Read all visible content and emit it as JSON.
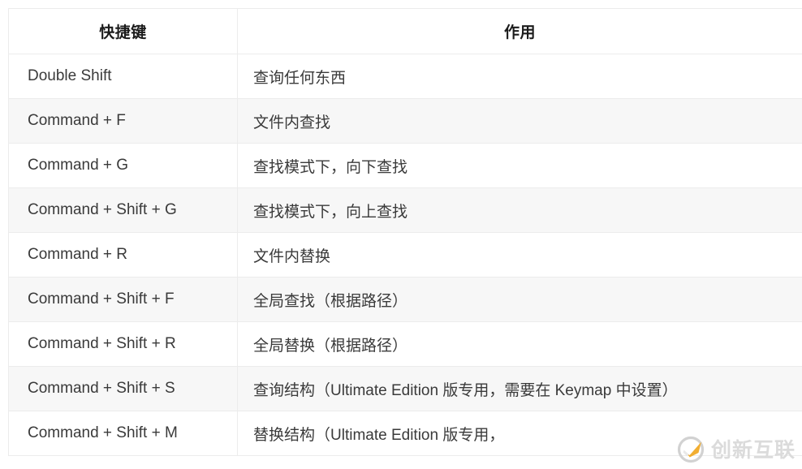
{
  "table": {
    "headers": [
      {
        "label": "快捷键"
      },
      {
        "label": "作用"
      }
    ],
    "rows": [
      {
        "key": "Double Shift",
        "desc": "查询任何东西"
      },
      {
        "key": "Command + F",
        "desc": "文件内查找"
      },
      {
        "key": "Command + G",
        "desc": "查找模式下，向下查找"
      },
      {
        "key": "Command + Shift + G",
        "desc": "查找模式下，向上查找"
      },
      {
        "key": "Command + R",
        "desc": "文件内替换"
      },
      {
        "key": "Command + Shift + F",
        "desc": "全局查找（根据路径）"
      },
      {
        "key": "Command + Shift + R",
        "desc": "全局替换（根据路径）"
      },
      {
        "key": "Command + Shift + S",
        "desc": "查询结构（Ultimate Edition 版专用，需要在 Keymap 中设置）"
      },
      {
        "key": "Command + Shift + M",
        "desc": "替换结构（Ultimate Edition 版专用，"
      }
    ]
  },
  "watermark": {
    "text": "创新互联",
    "logo_icon": "circle-swoosh-logo-icon",
    "colors": {
      "swoosh": "#f0a821",
      "ring": "#c9c9c9",
      "text": "#d9d9d9"
    }
  },
  "colors": {
    "row_stripe": "#f7f7f7",
    "row_plain": "#ffffff",
    "border": "#ececec",
    "header_text": "#1b1b1b",
    "body_text": "#3a3a3a"
  }
}
